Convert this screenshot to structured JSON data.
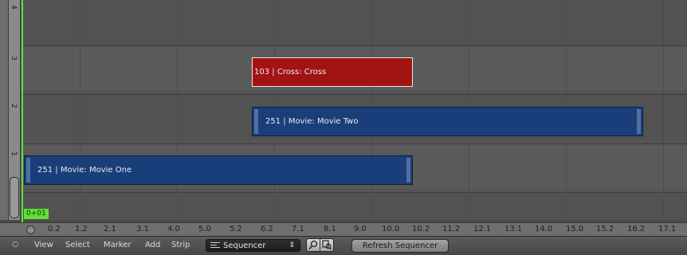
{
  "channels": [
    "0",
    "1",
    "2",
    "3",
    "4"
  ],
  "strips": [
    {
      "label": "103 | Cross: Cross",
      "channel": 3,
      "color": "#a21313"
    },
    {
      "label": "251 | Movie: Movie Two",
      "channel": 2,
      "color": "#1a3e79"
    },
    {
      "label": "251 | Movie: Movie One",
      "channel": 1,
      "color": "#1a3e79"
    }
  ],
  "current_frame": "0+01",
  "time_ruler": {
    "ticks": [
      "0.2",
      "1.2",
      "2.1",
      "3.1",
      "4.0",
      "5.0",
      "5.2",
      "6.2",
      "7.1",
      "8.1",
      "9.0",
      "10.0",
      "10.2",
      "11.2",
      "12.1",
      "13.1",
      "14.0",
      "15.0",
      "15.2",
      "16.2",
      "17.1"
    ]
  },
  "header": {
    "menus": [
      "View",
      "Select",
      "Marker",
      "Add",
      "Strip"
    ],
    "view_type": "Sequencer",
    "refresh_button": "Refresh Sequencer"
  },
  "colors": {
    "playhead": "#5ee035",
    "cross_strip": "#a21313",
    "movie_strip": "#1a3e79"
  }
}
